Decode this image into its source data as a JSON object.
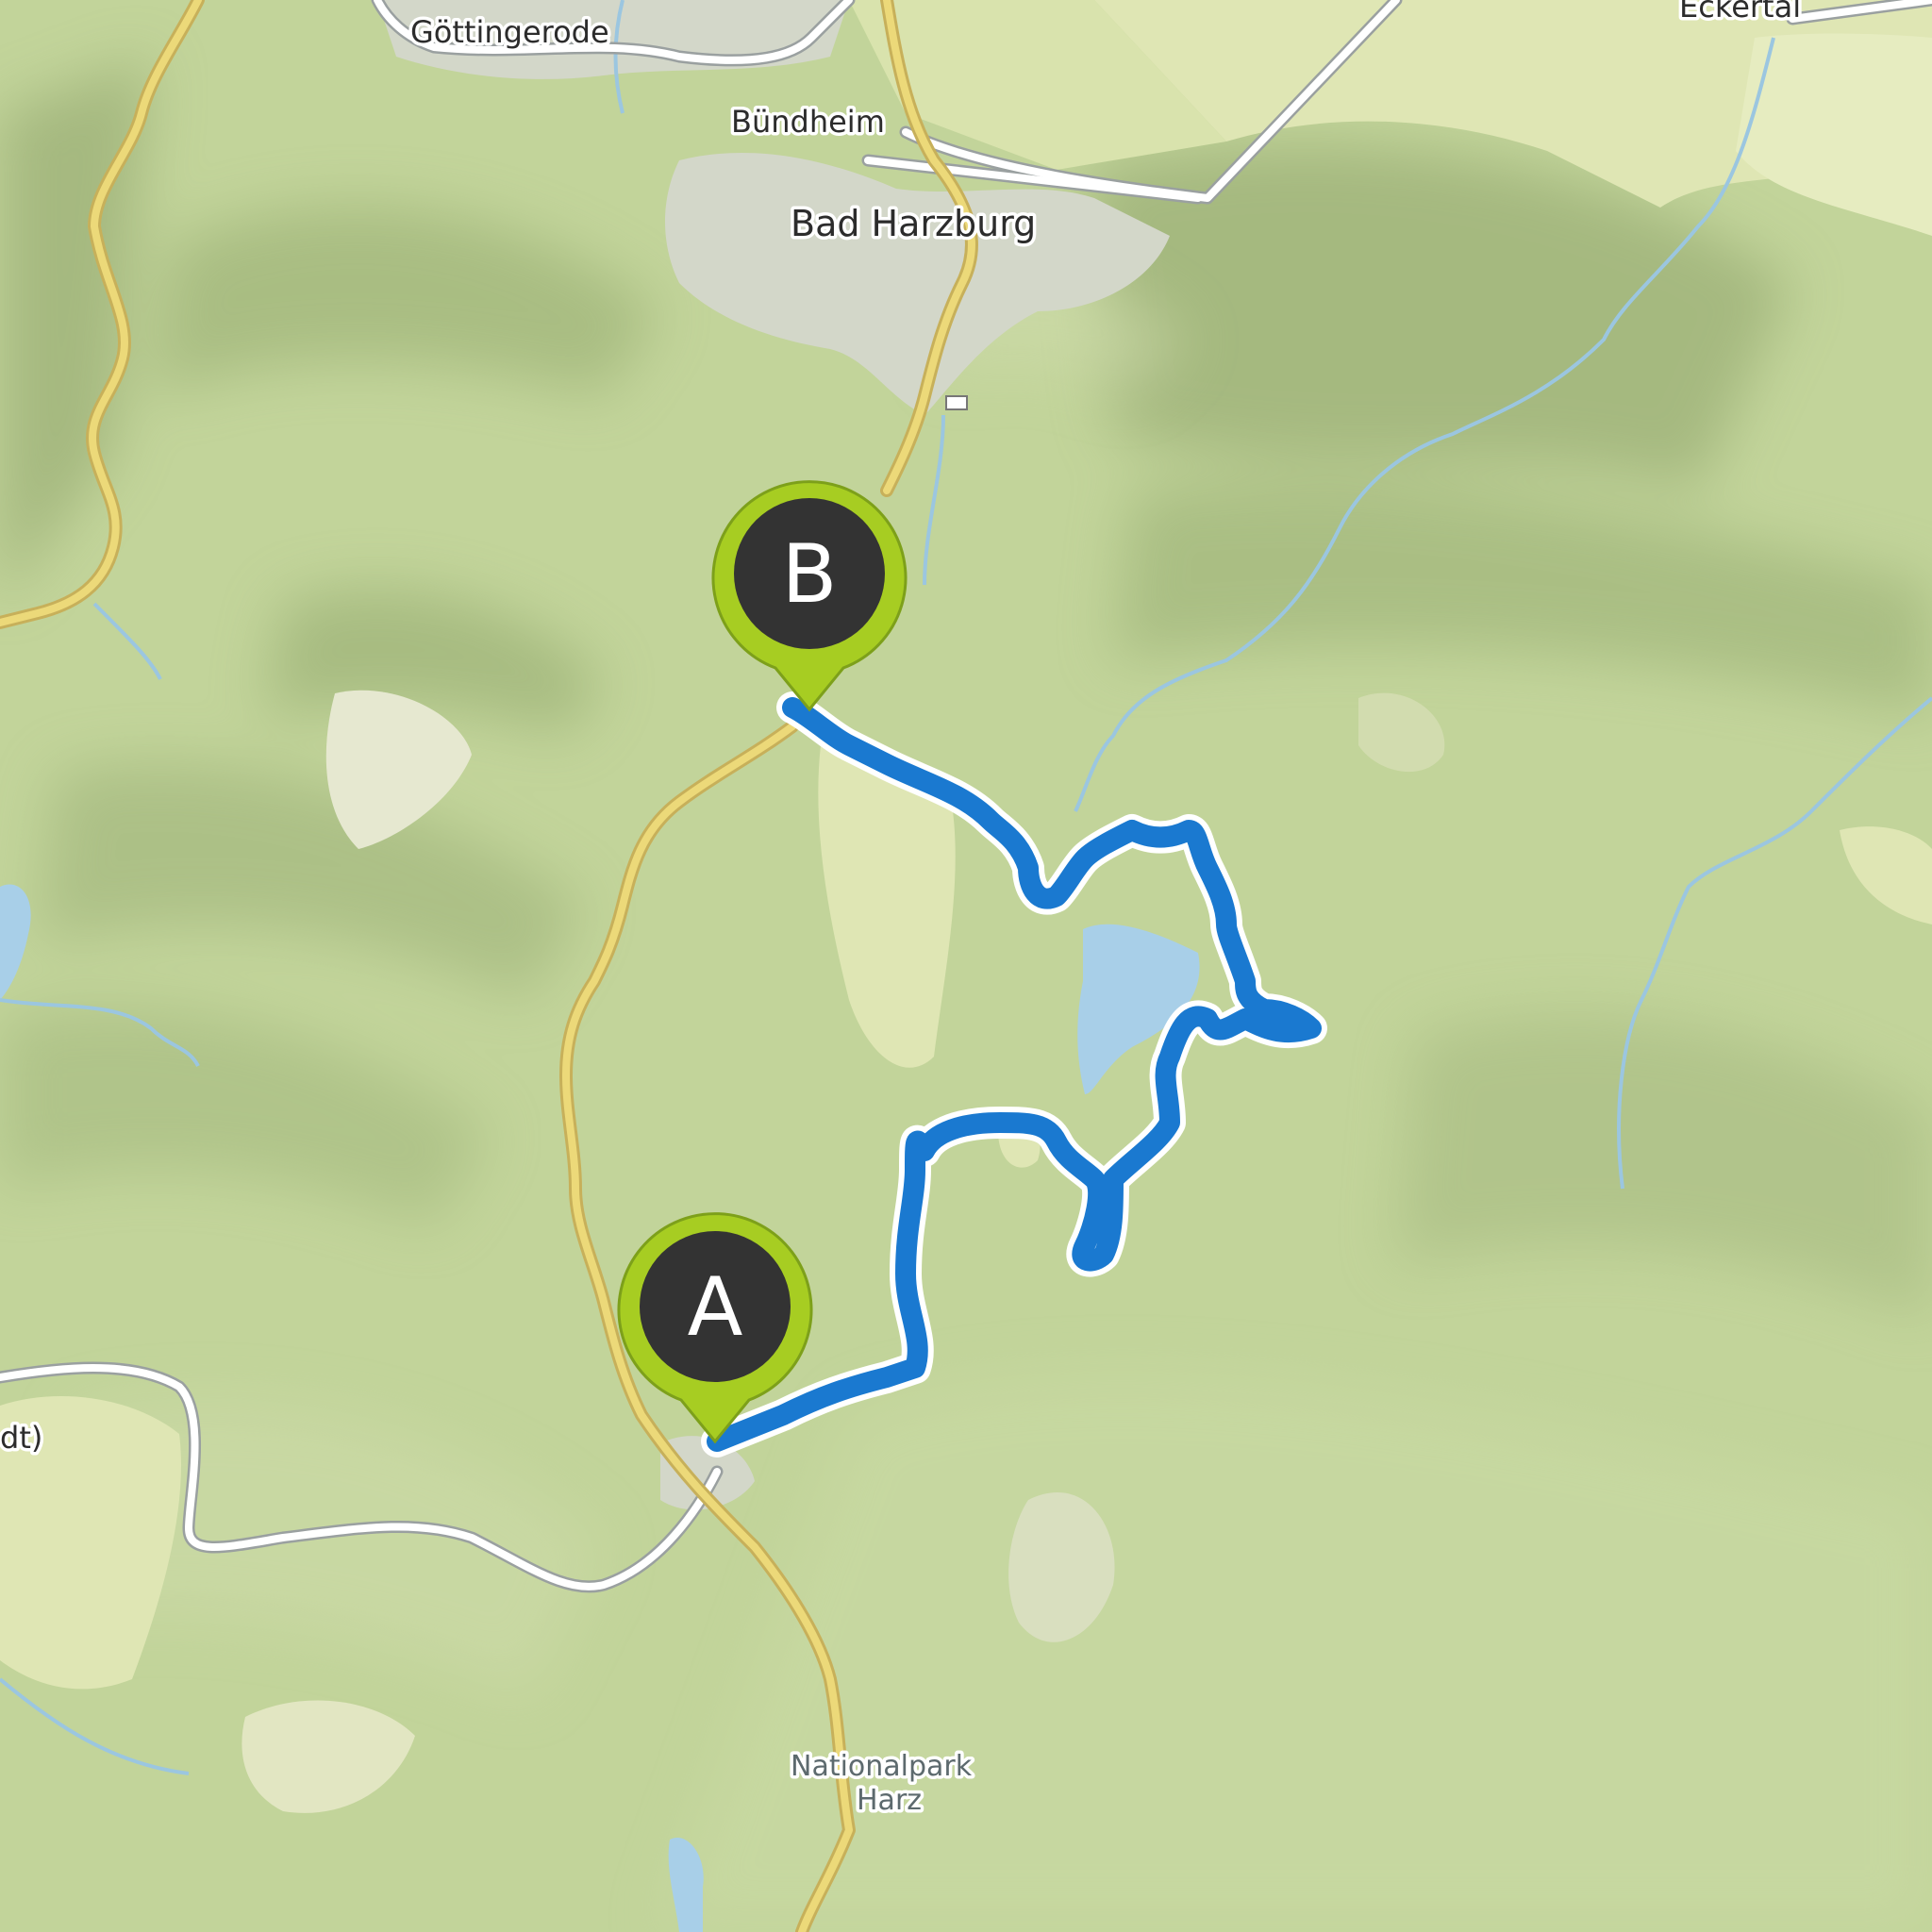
{
  "map": {
    "colors": {
      "forest": "#c2d49a",
      "forest_dark": "#9db278",
      "open_land": "#dfe6b4",
      "urban": "#d3d7c9",
      "water": "#a8cfe8",
      "main_road": "#ecd979",
      "secondary_road": "#ffffff",
      "route": "#1a79d0",
      "route_halo": "#ffffff",
      "marker_ring": "#a7cd22",
      "marker_fill": "#333333"
    },
    "places": {
      "goettingerode": "Göttingerode",
      "buendheim": "Bündheim",
      "bad_harzburg": "Bad Harzburg",
      "eckertal": "Eckertal",
      "partial_left": "dt)",
      "nationalpark_line1": "Nationalpark",
      "nationalpark_line2": "Harz"
    },
    "markers": {
      "start": {
        "label": "A",
        "icon": "map-pin-icon"
      },
      "end": {
        "label": "B",
        "icon": "map-pin-icon"
      }
    }
  }
}
